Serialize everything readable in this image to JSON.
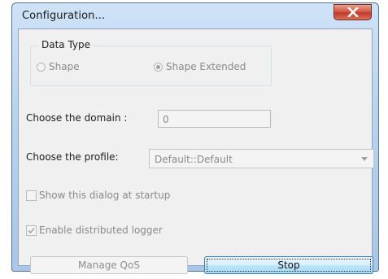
{
  "window": {
    "title": "Configuration..."
  },
  "data_type": {
    "legend": "Data Type",
    "options": [
      {
        "label": "Shape",
        "selected": false
      },
      {
        "label": "Shape Extended",
        "selected": true
      }
    ]
  },
  "domain": {
    "label": "Choose the domain :",
    "value": "0"
  },
  "profile": {
    "label": "Choose the profile:",
    "selected": "Default::Default"
  },
  "options": {
    "show_dialog": {
      "label": "Show this dialog at startup",
      "checked": false
    },
    "distributed_logger": {
      "label": "Enable distributed logger",
      "checked": true
    }
  },
  "buttons": {
    "manage_qos": "Manage QoS",
    "stop": "Stop"
  },
  "colors": {
    "title_bar": "#b9d3ef",
    "close_button": "#c0392b",
    "default_button_border": "#3c7fb1"
  }
}
